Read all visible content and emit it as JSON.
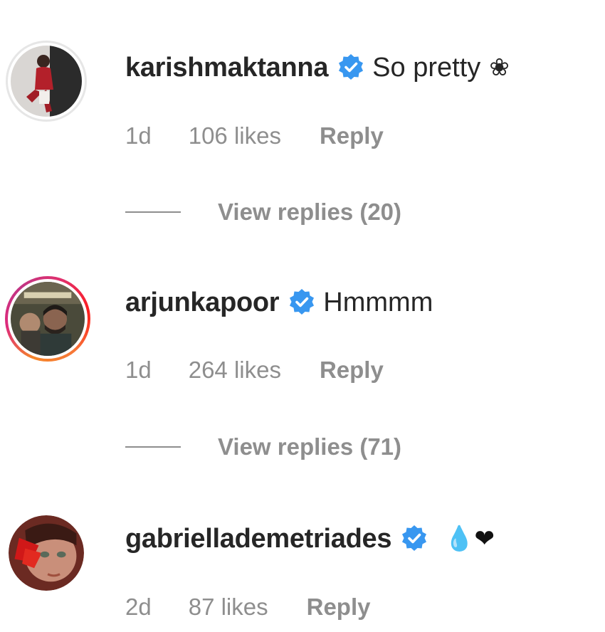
{
  "comments": [
    {
      "username": "karishmaktanna",
      "text": "So pretty",
      "emoji": "❀",
      "time": "1d",
      "likes": "106 likes",
      "reply_label": "Reply",
      "view_replies": "View replies (20)",
      "verified": true
    },
    {
      "username": "arjunkapoor",
      "text": "Hmmmm",
      "emoji": "",
      "time": "1d",
      "likes": "264 likes",
      "reply_label": "Reply",
      "view_replies": "View replies (71)",
      "verified": true
    },
    {
      "username": "gabriellademe­triades",
      "text": "",
      "emoji": "💧❤",
      "time": "2d",
      "likes": "87 likes",
      "reply_label": "Reply",
      "verified": true
    }
  ],
  "colors": {
    "text_primary": "#262626",
    "text_secondary": "#8e8e8e",
    "verified_blue": "#3897f0"
  },
  "icons": {
    "verified": "verified-badge-icon"
  }
}
